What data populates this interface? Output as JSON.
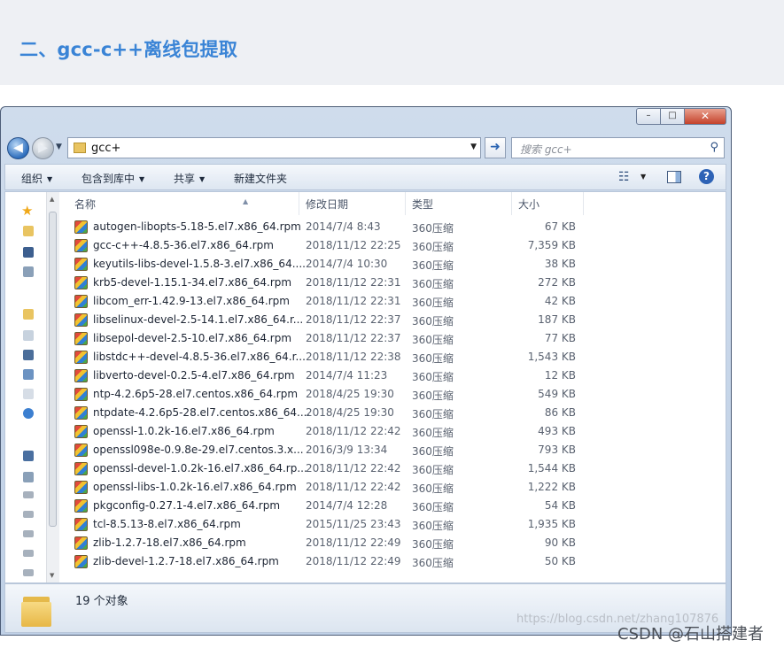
{
  "page": {
    "heading": "二、gcc-c++离线包提取"
  },
  "window": {
    "controls": {
      "minimize": "–",
      "maximize": "□",
      "close": "✕"
    },
    "address": {
      "path": "gcc+"
    },
    "search": {
      "placeholder": "搜索 gcc+"
    },
    "toolbar": {
      "organize": "组织",
      "include_library": "包含到库中",
      "share": "共享",
      "new_folder": "新建文件夹"
    },
    "columns": {
      "name": "名称",
      "date": "修改日期",
      "type": "类型",
      "size": "大小"
    },
    "files": [
      {
        "name": "autogen-libopts-5.18-5.el7.x86_64.rpm",
        "date": "2014/7/4 8:43",
        "type": "360压缩",
        "size": "67 KB"
      },
      {
        "name": "gcc-c++-4.8.5-36.el7.x86_64.rpm",
        "date": "2018/11/12 22:25",
        "type": "360压缩",
        "size": "7,359 KB"
      },
      {
        "name": "keyutils-libs-devel-1.5.8-3.el7.x86_64....",
        "date": "2014/7/4 10:30",
        "type": "360压缩",
        "size": "38 KB"
      },
      {
        "name": "krb5-devel-1.15.1-34.el7.x86_64.rpm",
        "date": "2018/11/12 22:31",
        "type": "360压缩",
        "size": "272 KB"
      },
      {
        "name": "libcom_err-1.42.9-13.el7.x86_64.rpm",
        "date": "2018/11/12 22:31",
        "type": "360压缩",
        "size": "42 KB"
      },
      {
        "name": "libselinux-devel-2.5-14.1.el7.x86_64.r...",
        "date": "2018/11/12 22:37",
        "type": "360压缩",
        "size": "187 KB"
      },
      {
        "name": "libsepol-devel-2.5-10.el7.x86_64.rpm",
        "date": "2018/11/12 22:37",
        "type": "360压缩",
        "size": "77 KB"
      },
      {
        "name": "libstdc++-devel-4.8.5-36.el7.x86_64.r...",
        "date": "2018/11/12 22:38",
        "type": "360压缩",
        "size": "1,543 KB"
      },
      {
        "name": "libverto-devel-0.2.5-4.el7.x86_64.rpm",
        "date": "2014/7/4 11:23",
        "type": "360压缩",
        "size": "12 KB"
      },
      {
        "name": "ntp-4.2.6p5-28.el7.centos.x86_64.rpm",
        "date": "2018/4/25 19:30",
        "type": "360压缩",
        "size": "549 KB"
      },
      {
        "name": "ntpdate-4.2.6p5-28.el7.centos.x86_64....",
        "date": "2018/4/25 19:30",
        "type": "360压缩",
        "size": "86 KB"
      },
      {
        "name": "openssl-1.0.2k-16.el7.x86_64.rpm",
        "date": "2018/11/12 22:42",
        "type": "360压缩",
        "size": "493 KB"
      },
      {
        "name": "openssl098e-0.9.8e-29.el7.centos.3.x...",
        "date": "2016/3/9 13:34",
        "type": "360压缩",
        "size": "793 KB"
      },
      {
        "name": "openssl-devel-1.0.2k-16.el7.x86_64.rp...",
        "date": "2018/11/12 22:42",
        "type": "360压缩",
        "size": "1,544 KB"
      },
      {
        "name": "openssl-libs-1.0.2k-16.el7.x86_64.rpm",
        "date": "2018/11/12 22:42",
        "type": "360压缩",
        "size": "1,222 KB"
      },
      {
        "name": "pkgconfig-0.27.1-4.el7.x86_64.rpm",
        "date": "2014/7/4 12:28",
        "type": "360压缩",
        "size": "54 KB"
      },
      {
        "name": "tcl-8.5.13-8.el7.x86_64.rpm",
        "date": "2015/11/25 23:43",
        "type": "360压缩",
        "size": "1,935 KB"
      },
      {
        "name": "zlib-1.2.7-18.el7.x86_64.rpm",
        "date": "2018/11/12 22:49",
        "type": "360压缩",
        "size": "90 KB"
      },
      {
        "name": "zlib-devel-1.2.7-18.el7.x86_64.rpm",
        "date": "2018/11/12 22:49",
        "type": "360压缩",
        "size": "50 KB"
      }
    ],
    "status": {
      "count": "19 个对象"
    }
  },
  "watermark": {
    "url": "https://blog.csdn.net/zhang107876",
    "credit": "CSDN @石山搭建者"
  }
}
